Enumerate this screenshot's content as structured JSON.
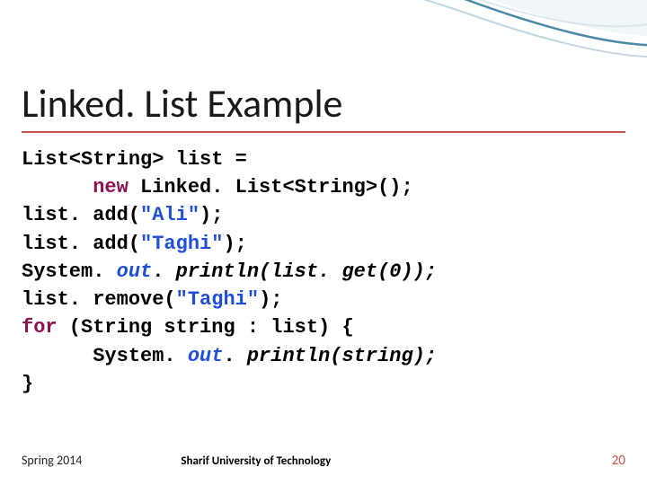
{
  "title": "Linked. List Example",
  "code": {
    "l1a": "List<String> list = ",
    "l2a": "      ",
    "l2_new": "new",
    "l2b": " Linked. List<String>();",
    "l3a": "list. add(",
    "l3s": "\"Ali\"",
    "l3b": ");",
    "l4a": "list. add(",
    "l4s": "\"Taghi\"",
    "l4b": ");",
    "l5a": "System. ",
    "l5_out": "out",
    "l5b": ". ",
    "l5_call": "println(list. get(0));",
    "l6a": "list. remove(",
    "l6s": "\"Taghi\"",
    "l6b": ");",
    "l7_for": "for",
    "l7a": " (String string : list) {",
    "l8a": "      System. ",
    "l8_out": "out",
    "l8b": ". ",
    "l8_call": "println(string);",
    "l9": "}"
  },
  "footer": {
    "left": "Spring 2014",
    "center": "Sharif University of Technology",
    "right": "20"
  }
}
